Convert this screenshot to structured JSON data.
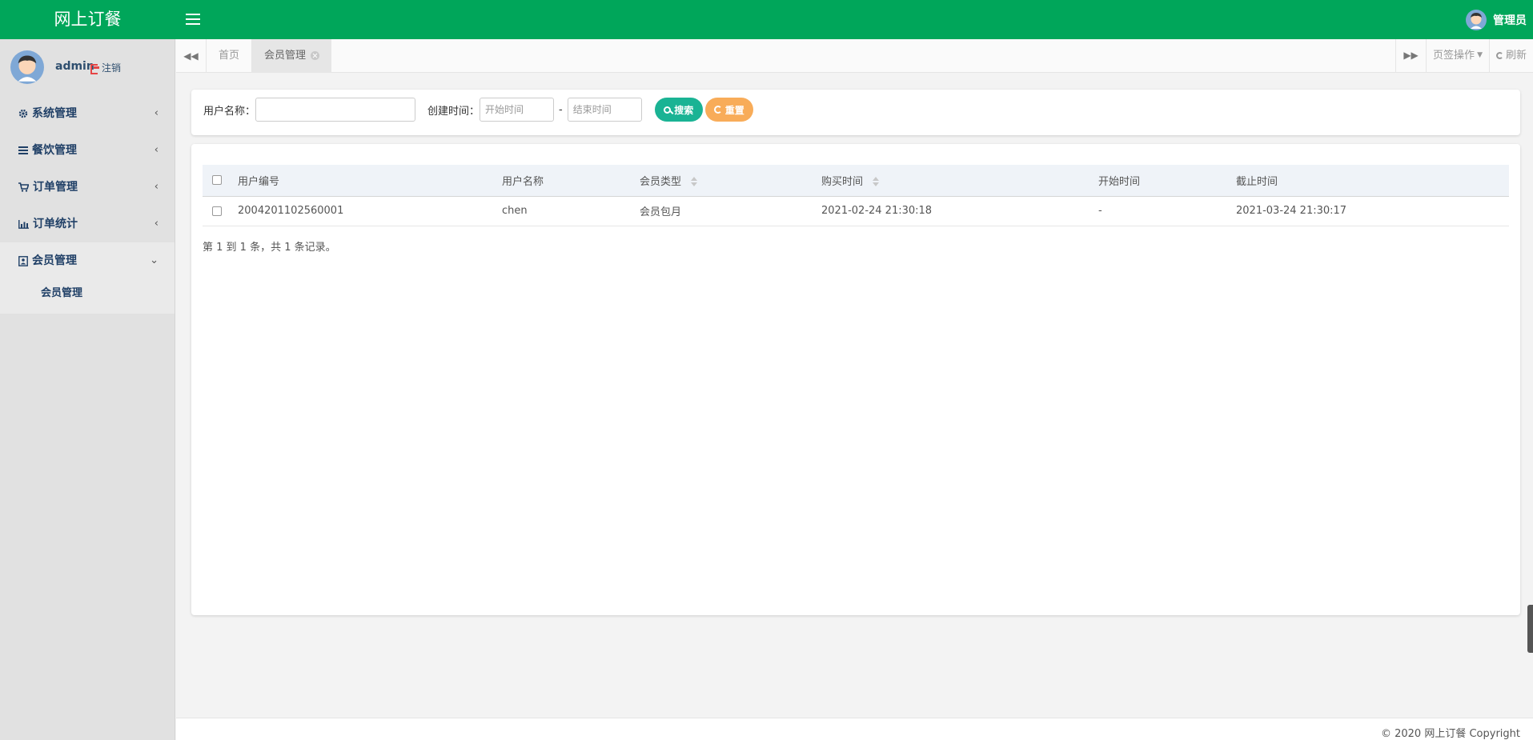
{
  "app": {
    "brand": "网上订餐"
  },
  "topbar": {
    "user_name": "管理员"
  },
  "sidebar": {
    "user": {
      "name": "admin",
      "logout_label": "注销"
    },
    "menu": [
      {
        "label": "系统管理",
        "icon": "gear-icon"
      },
      {
        "label": "餐饮管理",
        "icon": "list-icon"
      },
      {
        "label": "订单管理",
        "icon": "cart-icon"
      },
      {
        "label": "订单统计",
        "icon": "bar-chart-icon"
      },
      {
        "label": "会员管理",
        "icon": "member-card-icon",
        "expanded": true,
        "children": [
          {
            "label": "会员管理"
          }
        ]
      }
    ]
  },
  "tabs": {
    "home_label": "首页",
    "current_label": "会员管理",
    "page_ops_label": "页签操作",
    "refresh_label": "刷新"
  },
  "search": {
    "username_label": "用户名称：",
    "username_value": "",
    "created_label": "创建时间：",
    "start_placeholder": "开始时间",
    "end_placeholder": "结束时间",
    "range_separator": "-",
    "search_button": "搜索",
    "reset_button": "重置"
  },
  "table": {
    "headers": [
      "用户编号",
      "用户名称",
      "会员类型",
      "购买时间",
      "开始时间",
      "截止时间"
    ],
    "rows": [
      {
        "user_no": "2004201102560001",
        "username": "chen",
        "member_type": "会员包月",
        "purchase_time": "2021-02-24 21:30:18",
        "start_time": "-",
        "end_time": "2021-03-24 21:30:17"
      }
    ],
    "pager_info": "第 1 到 1 条，共 1 条记录。"
  },
  "footer": {
    "copyright": "© 2020 网上订餐 Copyright"
  },
  "colors": {
    "header_green": "#00a65a",
    "search_button": "#1ab394",
    "reset_button": "#f8ac59",
    "menu_text": "#1f3f66"
  }
}
